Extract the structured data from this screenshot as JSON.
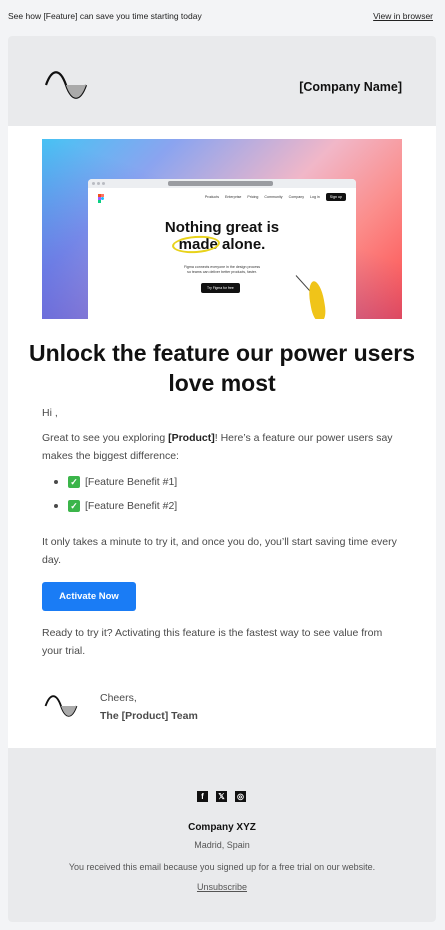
{
  "preheader": {
    "text": "See how [Feature] can save you time starting today",
    "view_in_browser": "View in browser"
  },
  "header": {
    "logo_icon": "sine-wave-logo-icon",
    "company_name": "[Company Name]"
  },
  "hero": {
    "headline_line1": "Nothing great is",
    "headline_line2": "made alone.",
    "subtext_line1": "Figma connects everyone in the design process",
    "subtext_line2": "so teams can deliver better products, faster.",
    "cta": "Try Figma for free",
    "nav": [
      "Products",
      "Enterprise",
      "Pricing",
      "Community",
      "Company",
      "Log in",
      "Sign up"
    ]
  },
  "main": {
    "title": "Unlock the feature our power users love most",
    "greeting": "Hi ,",
    "intro_prefix": "Great to see you exploring ",
    "intro_product": "[Product]",
    "intro_suffix": "! Here’s a feature our power users say makes the biggest difference:",
    "benefits": [
      "[Feature Benefit #1]",
      "[Feature Benefit #2]"
    ],
    "minute_text": "It only takes a minute to try it, and once you do, you’ll start saving time every day.",
    "cta_label": "Activate Now",
    "ready_text": "Ready to try it? Activating this feature is the fastest way to see value from your trial."
  },
  "signature": {
    "cheers": "Cheers,",
    "team": "The [Product] Team"
  },
  "footer": {
    "social_icons": [
      "facebook-icon",
      "x-icon",
      "instagram-icon"
    ],
    "company": "Company XYZ",
    "address": "Madrid, Spain",
    "reason": "You received this email because you signed up for a free trial on our website.",
    "unsubscribe": "Unsubscribe"
  },
  "colors": {
    "accent": "#1a7cf5",
    "header_bg": "#e9eaec",
    "page_bg": "#f3f4f6"
  }
}
